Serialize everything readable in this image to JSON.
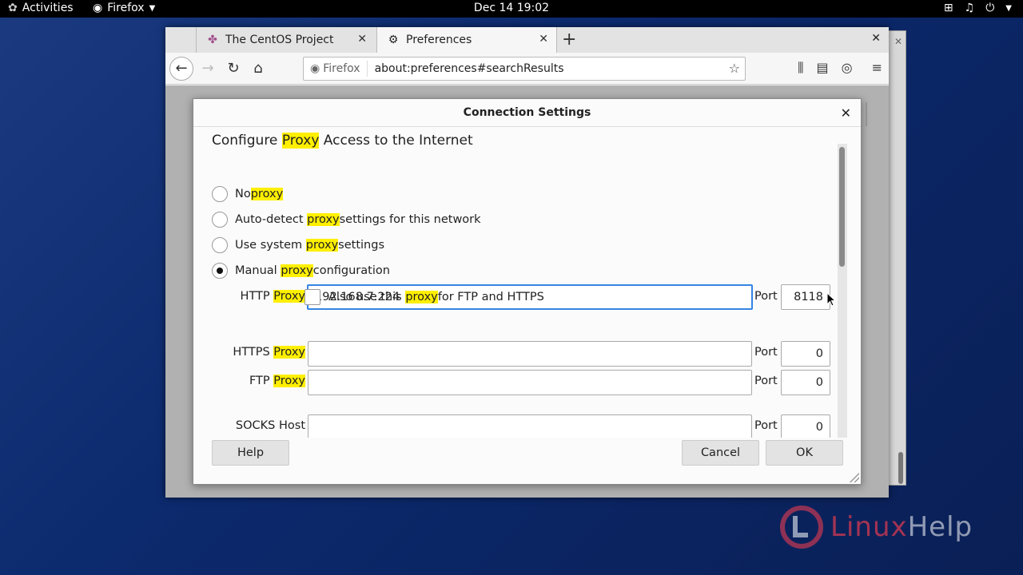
{
  "topbar": {
    "activities": "Activities",
    "app_name": "Firefox",
    "clock": "Dec 14  19:02"
  },
  "browser": {
    "tabs": [
      {
        "title": "The CentOS Project",
        "icon": "centos-logo-icon"
      },
      {
        "title": "Preferences",
        "icon": "gear-icon"
      }
    ],
    "identity_label": "Firefox",
    "url": "about:preferences#searchResults"
  },
  "dialog": {
    "title": "Connection Settings",
    "heading_before": "Configure ",
    "heading_highlight": "Proxy",
    "heading_after": " Access to the Internet",
    "options": [
      {
        "before": "No ",
        "highlight": "proxy",
        "after": "",
        "selected": false
      },
      {
        "before": "Auto-detect ",
        "highlight": "proxy",
        "after": " settings for this network",
        "selected": false
      },
      {
        "before": "Use system ",
        "highlight": "proxy",
        "after": " settings",
        "selected": false
      },
      {
        "before": "Manual ",
        "highlight": "proxy",
        "after": " configuration",
        "selected": true
      }
    ],
    "http": {
      "label": "HTTP ",
      "label_hl": "Proxy",
      "value": "192.168.7.224",
      "port_label": "Port",
      "port": "8118"
    },
    "share_checkbox": {
      "before": "Also use this ",
      "highlight": "proxy",
      "after": " for FTP and HTTPS",
      "checked": false
    },
    "https": {
      "label": "HTTPS ",
      "label_hl": "Proxy",
      "value": "",
      "port_label": "Port",
      "port": "0"
    },
    "ftp": {
      "label": "FTP ",
      "label_hl": "Proxy",
      "value": "",
      "port_label": "Port",
      "port": "0"
    },
    "socks": {
      "label": "SOCKS Host",
      "value": "",
      "port_label": "Port",
      "port": "0"
    },
    "buttons": {
      "help": "Help",
      "cancel": "Cancel",
      "ok": "OK"
    }
  },
  "watermark": {
    "part1": "Linux",
    "part2": "Help"
  }
}
